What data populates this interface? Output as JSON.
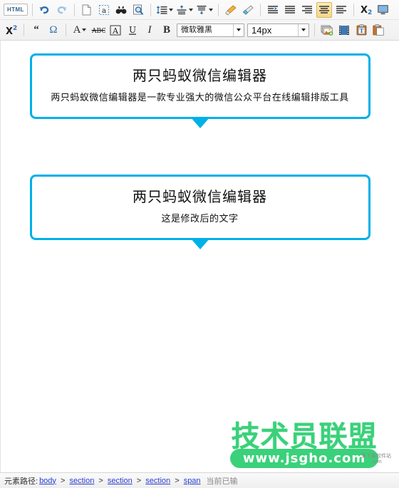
{
  "toolbar": {
    "row1": [
      {
        "name": "html-source-button",
        "type": "boxed",
        "label": "HTML",
        "interactable": true
      },
      {
        "name": "separator",
        "type": "sep",
        "interactable": false
      },
      {
        "name": "undo-button",
        "type": "icon",
        "icon": "undo-icon",
        "interactable": true
      },
      {
        "name": "redo-button",
        "type": "icon",
        "icon": "redo-icon",
        "interactable": true
      },
      {
        "name": "separator",
        "type": "sep",
        "interactable": false
      },
      {
        "name": "new-document-button",
        "type": "icon",
        "icon": "page-icon",
        "interactable": true
      },
      {
        "name": "select-all-button",
        "type": "icon",
        "icon": "select-all-icon",
        "interactable": true
      },
      {
        "name": "find-replace-button",
        "type": "icon",
        "icon": "binoculars-icon",
        "interactable": true
      },
      {
        "name": "preview-button",
        "type": "icon",
        "icon": "magnifier-page-icon",
        "interactable": true
      },
      {
        "name": "separator",
        "type": "sep",
        "interactable": false
      },
      {
        "name": "line-height-button",
        "type": "icon-caret",
        "icon": "line-height-icon",
        "interactable": true
      },
      {
        "name": "paragraph-spacing-before-button",
        "type": "icon-caret",
        "icon": "space-before-icon",
        "interactable": true
      },
      {
        "name": "paragraph-spacing-after-button",
        "type": "icon-caret",
        "icon": "space-after-icon",
        "interactable": true
      },
      {
        "name": "separator",
        "type": "sep",
        "interactable": false
      },
      {
        "name": "format-painter-button",
        "type": "icon",
        "icon": "brush-icon",
        "interactable": true
      },
      {
        "name": "clear-format-button",
        "type": "icon",
        "icon": "eraser-icon",
        "interactable": true
      },
      {
        "name": "separator",
        "type": "sep",
        "interactable": false
      },
      {
        "name": "indent-button",
        "type": "icon",
        "icon": "indent-icon",
        "interactable": true
      },
      {
        "name": "align-justify-button",
        "type": "icon",
        "icon": "align-justify-icon",
        "interactable": true
      },
      {
        "name": "align-right-button",
        "type": "icon",
        "icon": "align-right-icon",
        "interactable": true
      },
      {
        "name": "align-center-button",
        "type": "icon",
        "icon": "align-center-icon",
        "interactable": true,
        "active": true
      },
      {
        "name": "align-left-button",
        "type": "icon",
        "icon": "align-left-icon",
        "interactable": true
      },
      {
        "name": "separator",
        "type": "sep",
        "interactable": false
      },
      {
        "name": "subscript-button",
        "type": "icon",
        "icon": "subscript-icon",
        "interactable": true
      },
      {
        "name": "fullscreen-button",
        "type": "icon",
        "icon": "monitor-icon",
        "interactable": true
      }
    ],
    "row2": [
      {
        "name": "superscript-button",
        "type": "icon",
        "icon": "superscript-icon",
        "interactable": true
      },
      {
        "name": "separator",
        "type": "sep",
        "interactable": false
      },
      {
        "name": "blockquote-button",
        "type": "icon",
        "icon": "quote-icon",
        "interactable": true
      },
      {
        "name": "special-character-button",
        "type": "icon",
        "icon": "omega-icon",
        "interactable": true
      },
      {
        "name": "separator",
        "type": "sep",
        "interactable": false
      },
      {
        "name": "font-color-button",
        "type": "icon-caret",
        "icon": "font-color-icon",
        "interactable": true
      },
      {
        "name": "strikethrough-button",
        "type": "icon",
        "icon": "strikethrough-icon",
        "interactable": true
      },
      {
        "name": "background-color-button",
        "type": "icon",
        "icon": "text-background-icon",
        "interactable": true
      },
      {
        "name": "underline-button",
        "type": "icon",
        "icon": "underline-icon",
        "interactable": true
      },
      {
        "name": "italic-button",
        "type": "icon",
        "icon": "italic-icon",
        "interactable": true
      },
      {
        "name": "bold-button",
        "type": "icon",
        "icon": "bold-icon",
        "interactable": true
      }
    ],
    "font_family": {
      "value": "微软雅黑",
      "name": "font-family-select"
    },
    "font_size": {
      "value": "14px",
      "name": "font-size-select"
    },
    "row2_right": [
      {
        "name": "insert-image-button",
        "type": "icon",
        "icon": "image-icon",
        "interactable": true
      },
      {
        "name": "insert-video-button",
        "type": "icon",
        "icon": "film-icon",
        "interactable": true
      },
      {
        "name": "paste-as-text-button",
        "type": "icon",
        "icon": "paste-text-icon",
        "interactable": true
      },
      {
        "name": "paste-button",
        "type": "icon",
        "icon": "paste-icon",
        "interactable": true
      }
    ],
    "accent_active_bg": "#f8d88a"
  },
  "editor": {
    "accent_color": "#00b0e8",
    "cards": [
      {
        "title": "两只蚂蚁微信编辑器",
        "desc": "两只蚂蚁微信编辑器是一款专业强大的微信公众平台在线编辑排版工具"
      },
      {
        "title": "两只蚂蚁微信编辑器",
        "desc": "这是修改后的文字"
      }
    ]
  },
  "watermark": {
    "main": "技术员联盟",
    "url": "www.jsgho.com",
    "sub_line1": "爱下载软件站",
    "sub_line2": ".com",
    "color": "#3ad17a"
  },
  "statusbar": {
    "label": "元素路径:",
    "path": [
      "body",
      "section",
      "section",
      "section",
      "span"
    ],
    "separator": ">",
    "right_text": "当前已输"
  }
}
